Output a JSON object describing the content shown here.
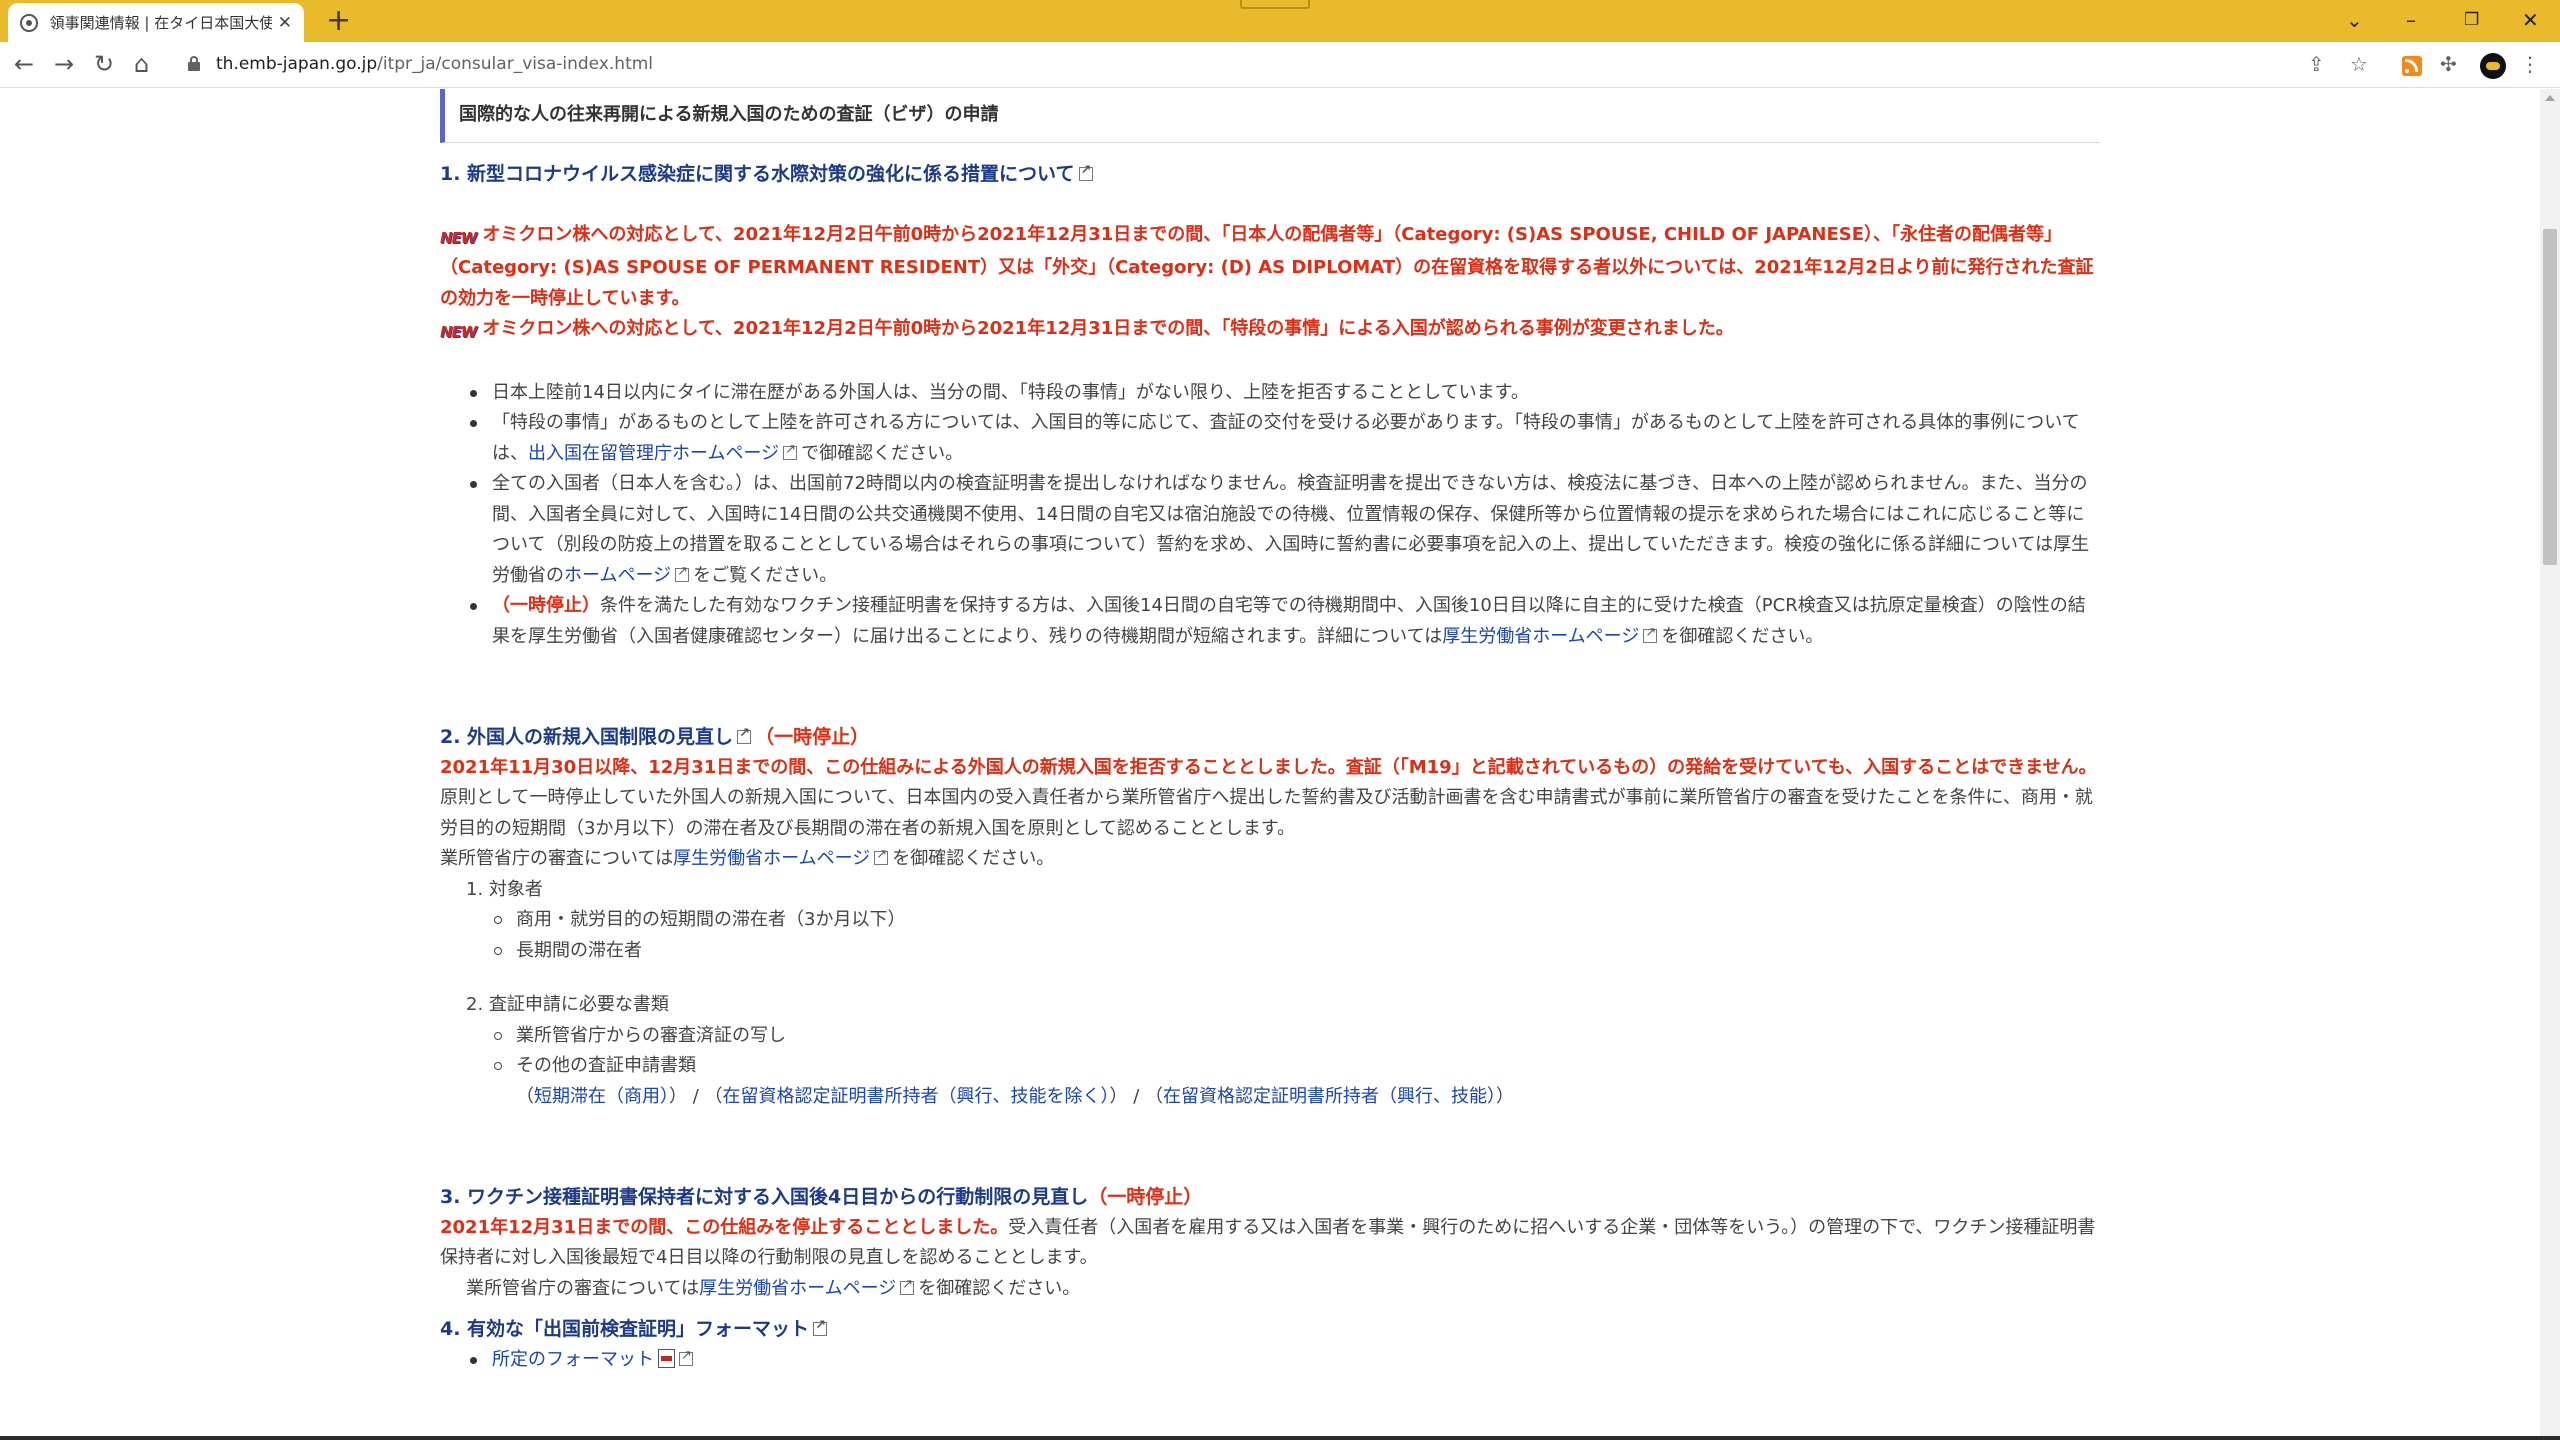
{
  "browser": {
    "tab_title": "領事関連情報 | 在タイ日本国大使館",
    "tab_close": "✕",
    "new_tab": "+",
    "url_host": "th.emb-japan.go.jp",
    "url_path": "/itpr_ja/consular_visa-index.html"
  },
  "page": {
    "banner": "国際的な人の往来再開による新規入国のための査証（ビザ）の申請",
    "new_label": "NEW",
    "s1": {
      "title": "1. 新型コロナウイルス感染症に関する水際対策の強化に係る措置について",
      "notice1": "オミクロン株への対応として、2021年12月2日午前0時から2021年12月31日までの間、「日本人の配偶者等」（Category: (S)AS SPOUSE, CHILD OF JAPANESE）、「永住者の配偶者等」（Category: (S)AS SPOUSE OF PERMANENT RESIDENT）又は「外交」（Category: (D) AS DIPLOMAT）の在留資格を取得する者以外については、2021年12月2日より前に発行された査証の効力を一時停止しています。",
      "notice2": "オミクロン株への対応として、2021年12月2日午前0時から2021年12月31日までの間、「特段の事情」による入国が認められる事例が変更されました。",
      "b1": "日本上陸前14日以内にタイに滞在歴がある外国人は、当分の間、「特段の事情」がない限り、上陸を拒否することとしています。",
      "b2_a": "「特段の事情」があるものとして上陸を許可される方については、入国目的等に応じて、査証の交付を受ける必要があります。「特段の事情」があるものとして上陸を許可される具体的事例については、",
      "b2_link": "出入国在留管理庁ホームページ",
      "b2_b": "で御確認ください。",
      "b3_a": "全ての入国者（日本人を含む。）は、出国前72時間以内の検査証明書を提出しなければなりません。検査証明書を提出できない方は、検疫法に基づき、日本への上陸が認められません。また、当分の間、入国者全員に対して、入国時に14日間の公共交通機関不使用、14日間の自宅又は宿泊施設での待機、位置情報の保存、保健所等から位置情報の提示を求められた場合にはこれに応じること等について（別段の防疫上の措置を取ることとしている場合はそれらの事項について）誓約を求め、入国時に誓約書に必要事項を記入の上、提出していただきます。検疫の強化に係る詳細については厚生労働省の",
      "b3_link": "ホームページ",
      "b3_b": "をご覧ください。",
      "b4_red": "（一時停止）",
      "b4_a": "条件を満たした有効なワクチン接種証明書を保持する方は、入国後14日間の自宅等での待機期間中、入国後10日目以降に自主的に受けた検査（PCR検査又は抗原定量検査）の陰性の結果を厚生労働省（入国者健康確認センター）に届け出ることにより、残りの待機期間が短縮されます。詳細については",
      "b4_link": "厚生労働省ホームページ",
      "b4_b": "を御確認ください。"
    },
    "s2": {
      "title": "2. 外国人の新規入国制限の見直し",
      "title_red": "（一時停止）",
      "red": "2021年11月30日以降、12月31日までの間、この仕組みによる外国人の新規入国を拒否することとしました。査証（「M19」と記載されているもの）の発給を受けていても、入国することはできません。",
      "p1": "原則として一時停止していた外国人の新規入国について、日本国内の受入責任者から業所管省庁へ提出した誓約書及び活動計画書を含む申請書式が事前に業所管省庁の審査を受けたことを条件に、商用・就労目的の短期間（3か月以下）の滞在者及び長期間の滞在者の新規入国を原則として認めることとします。",
      "p2_a": "業所管省庁の審査については",
      "p2_link": "厚生労働省ホームページ",
      "p2_b": "を御確認ください。",
      "ol1": "1. 対象者",
      "ol1_items": [
        "商用・就労目的の短期間の滞在者（3か月以下）",
        "長期間の滞在者"
      ],
      "ol2": "2. 査証申請に必要な書類",
      "ol2_items": [
        "業所管省庁からの審査済証の写し",
        "その他の査証申請書類"
      ],
      "forms_open": "（",
      "forms_link1": "短期滞在（商用）",
      "forms_sep": " / ",
      "forms_link2": "在留資格認定証明書所持者（興行、技能を除く）",
      "forms_link3": "在留資格認定証明書所持者（興行、技能）",
      "forms_close": "）"
    },
    "s3": {
      "title": "3. ワクチン接種証明書保持者に対する入国後4日目からの行動制限の見直し",
      "title_red": "（一時停止）",
      "red": "2021年12月31日までの間、この仕組みを停止することとしました。",
      "p1": "受入責任者（入国者を雇用する又は入国者を事業・興行のために招へいする企業・団体等をいう。）の管理の下で、ワクチン接種証明書保持者に対し入国後最短で4日目以降の行動制限の見直しを認めることとします。",
      "p2_a": "業所管省庁の審査については",
      "p2_link": "厚生労働省ホームページ",
      "p2_b": "を御確認ください。"
    },
    "s4": {
      "title": "4. 有効な「出国前検査証明」フォーマット",
      "item_link": "所定のフォーマット"
    }
  }
}
